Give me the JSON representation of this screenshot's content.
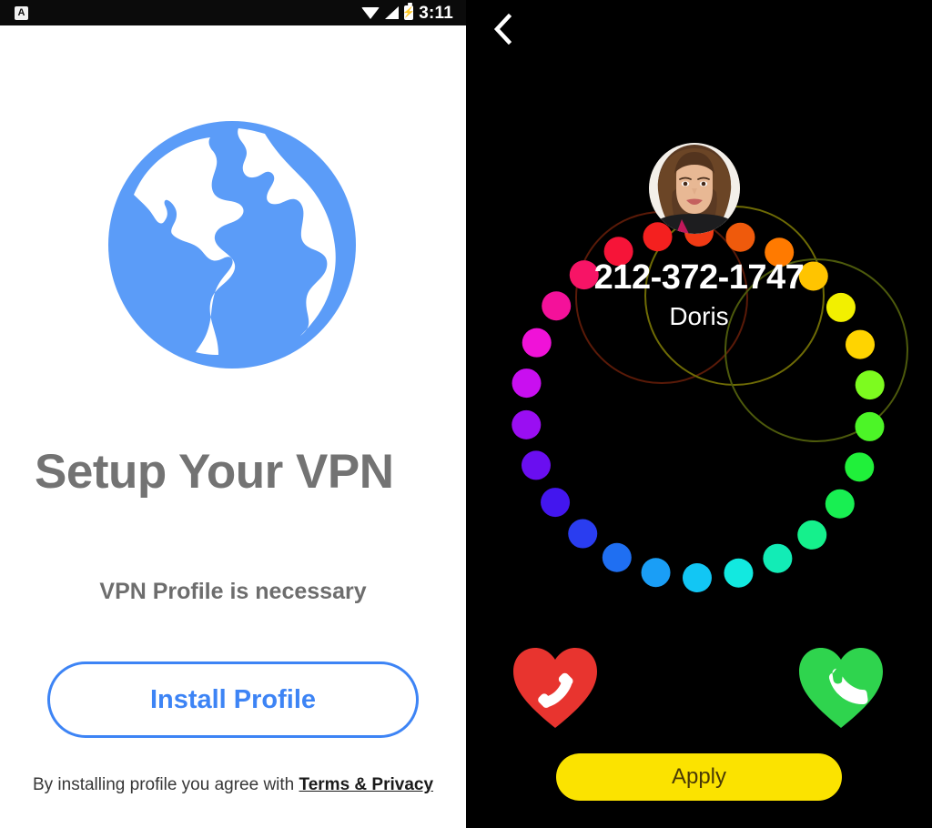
{
  "left_panel": {
    "status_bar": {
      "notification_icon_letter": "A",
      "notification_icon_name": "app-notification-icon",
      "wifi_icon": "wifi-icon",
      "signal_icon": "signal-bars-icon",
      "battery_icon": "battery-charging-icon",
      "battery_bolt_glyph": "⚡",
      "clock": "3:11"
    },
    "globe_icon_name": "globe-icon",
    "globe_color": "#5b9cf8",
    "heading": "Setup Your VPN",
    "subheading": "VPN Profile is necessary",
    "install_button_label": "Install Profile",
    "install_button_color": "#3d84f5",
    "terms_prefix": "By installing profile you agree with ",
    "terms_link_label": "Terms & Privacy"
  },
  "right_panel": {
    "back_icon_name": "chevron-left-icon",
    "avatar_name": "caller-avatar",
    "caller_number": "212-372-1747",
    "caller_name": "Doris",
    "decline_button_label": "decline-call",
    "decline_color": "#e8342f",
    "accept_button_label": "accept-call",
    "accept_color": "#2fd44e",
    "apply_button_label": "Apply",
    "apply_button_color": "#fbe300",
    "ring_dot_count": 26,
    "ring_dot_colors": [
      "#ff7a00",
      "#ffc400",
      "#f2f000",
      "#ffd400",
      "#7dfb1f",
      "#4cf527",
      "#20f03a",
      "#18ef52",
      "#15f08c",
      "#12ecb6",
      "#12e9e0",
      "#12c6f4",
      "#1a9ef6",
      "#1f6ff2",
      "#2a3df0",
      "#4316ee",
      "#6a0ef0",
      "#9a0ef2",
      "#c90ff0",
      "#f012d8",
      "#f4119a",
      "#f71466",
      "#f61438",
      "#f4201f",
      "#f13a14",
      "#ef5a0c"
    ],
    "faint_ring_colors": [
      "#5a1a08",
      "#6e6b05",
      "#4d5a0c"
    ]
  }
}
